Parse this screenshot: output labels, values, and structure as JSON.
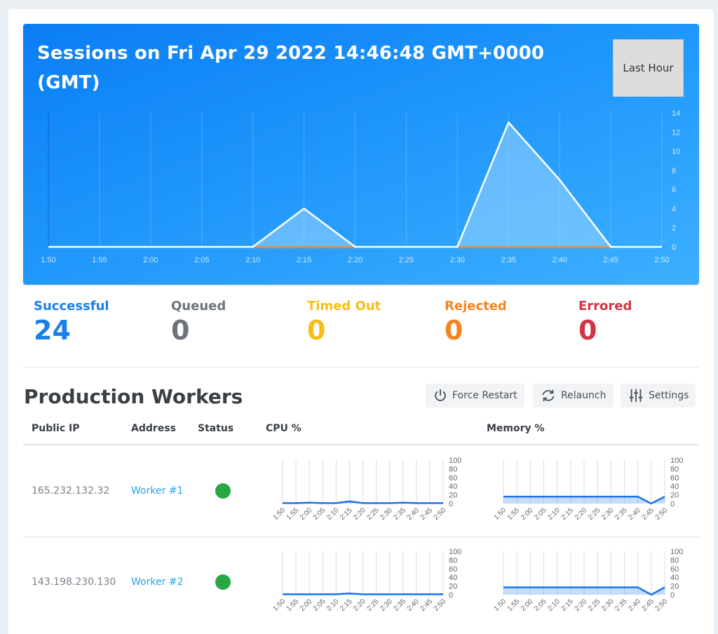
{
  "hero": {
    "title": "Sessions on Fri Apr 29 2022 14:46:48 GMT+0000 (GMT)",
    "range_button": "Last Hour"
  },
  "chart_data": [
    {
      "id": "sessions",
      "type": "area",
      "title": "Sessions on Fri Apr 29 2022 14:46:48 GMT+0000 (GMT)",
      "x": [
        "1:50",
        "1:55",
        "2:00",
        "2:05",
        "2:10",
        "2:15",
        "2:20",
        "2:25",
        "2:30",
        "2:35",
        "2:40",
        "2:45",
        "2:50"
      ],
      "ylim": [
        0,
        14
      ],
      "yticks": [
        0,
        2,
        4,
        6,
        8,
        10,
        12,
        14
      ],
      "grid": true,
      "y_axis_side": "right",
      "series": [
        {
          "name": "Successful",
          "color": "#ffffff",
          "values": [
            0,
            0,
            0,
            0,
            0,
            4,
            0,
            0,
            0,
            13,
            7,
            0,
            0
          ]
        },
        {
          "name": "Rejected",
          "color": "#e8893a",
          "values": [
            0,
            0,
            0,
            0,
            0,
            0,
            0,
            0,
            0,
            0,
            0,
            0,
            0
          ]
        }
      ]
    },
    {
      "id": "worker1-cpu",
      "type": "area",
      "title": "Worker #1 CPU %",
      "x": [
        "1:50",
        "1:55",
        "2:00",
        "2:05",
        "2:10",
        "2:15",
        "2:20",
        "2:25",
        "2:30",
        "2:35",
        "2:40",
        "2:45",
        "2:50"
      ],
      "ylim": [
        0,
        100
      ],
      "yticks": [
        0,
        20,
        40,
        60,
        80,
        100
      ],
      "series": [
        {
          "name": "CPU %",
          "color": "#1a73e8",
          "values": [
            1,
            1,
            2,
            1,
            1,
            5,
            1,
            1,
            1,
            2,
            1,
            1,
            1
          ]
        }
      ]
    },
    {
      "id": "worker1-memory",
      "type": "area",
      "title": "Worker #1 Memory %",
      "x": [
        "1:50",
        "1:55",
        "2:00",
        "2:05",
        "2:10",
        "2:15",
        "2:20",
        "2:25",
        "2:30",
        "2:35",
        "2:40",
        "2:45",
        "2:50"
      ],
      "ylim": [
        0,
        100
      ],
      "yticks": [
        0,
        20,
        40,
        60,
        80,
        100
      ],
      "series": [
        {
          "name": "Memory %",
          "color": "#1a73e8",
          "values": [
            16,
            16,
            16,
            16,
            16,
            16,
            16,
            16,
            16,
            16,
            16,
            0,
            16
          ]
        }
      ]
    },
    {
      "id": "worker2-cpu",
      "type": "area",
      "title": "Worker #2 CPU %",
      "x": [
        "1:50",
        "1:55",
        "2:00",
        "2:05",
        "2:10",
        "2:15",
        "2:20",
        "2:25",
        "2:30",
        "2:35",
        "2:40",
        "2:45",
        "2:50"
      ],
      "ylim": [
        0,
        100
      ],
      "yticks": [
        0,
        20,
        40,
        60,
        80,
        100
      ],
      "series": [
        {
          "name": "CPU %",
          "color": "#1a73e8",
          "values": [
            1,
            1,
            1,
            1,
            1,
            3,
            1,
            1,
            1,
            1,
            1,
            1,
            1
          ]
        }
      ]
    },
    {
      "id": "worker2-memory",
      "type": "area",
      "title": "Worker #2 Memory %",
      "x": [
        "1:50",
        "1:55",
        "2:00",
        "2:05",
        "2:10",
        "2:15",
        "2:20",
        "2:25",
        "2:30",
        "2:35",
        "2:40",
        "2:45",
        "2:50"
      ],
      "ylim": [
        0,
        100
      ],
      "yticks": [
        0,
        20,
        40,
        60,
        80,
        100
      ],
      "series": [
        {
          "name": "Memory %",
          "color": "#1a73e8",
          "values": [
            17,
            17,
            17,
            17,
            17,
            17,
            17,
            17,
            17,
            17,
            17,
            0,
            17
          ]
        }
      ]
    }
  ],
  "stats": [
    {
      "label": "Successful",
      "value": "24",
      "color": "#1a7fe8"
    },
    {
      "label": "Queued",
      "value": "0",
      "color": "#6c737a"
    },
    {
      "label": "Timed Out",
      "value": "0",
      "color": "#f7be16"
    },
    {
      "label": "Rejected",
      "value": "0",
      "color": "#f5841f"
    },
    {
      "label": "Errored",
      "value": "0",
      "color": "#d13545"
    }
  ],
  "workers": {
    "title": "Production Workers",
    "actions": [
      {
        "label": "Force Restart",
        "icon": "power-icon"
      },
      {
        "label": "Relaunch",
        "icon": "refresh-icon"
      },
      {
        "label": "Settings",
        "icon": "sliders-icon"
      }
    ],
    "columns": [
      "Public IP",
      "Address",
      "Status",
      "CPU %",
      "Memory %"
    ],
    "rows": [
      {
        "ip": "165.232.132.32",
        "address": "Worker #1",
        "status": "online",
        "status_color": "#28a745"
      },
      {
        "ip": "143.198.230.130",
        "address": "Worker #2",
        "status": "online",
        "status_color": "#28a745"
      }
    ]
  }
}
